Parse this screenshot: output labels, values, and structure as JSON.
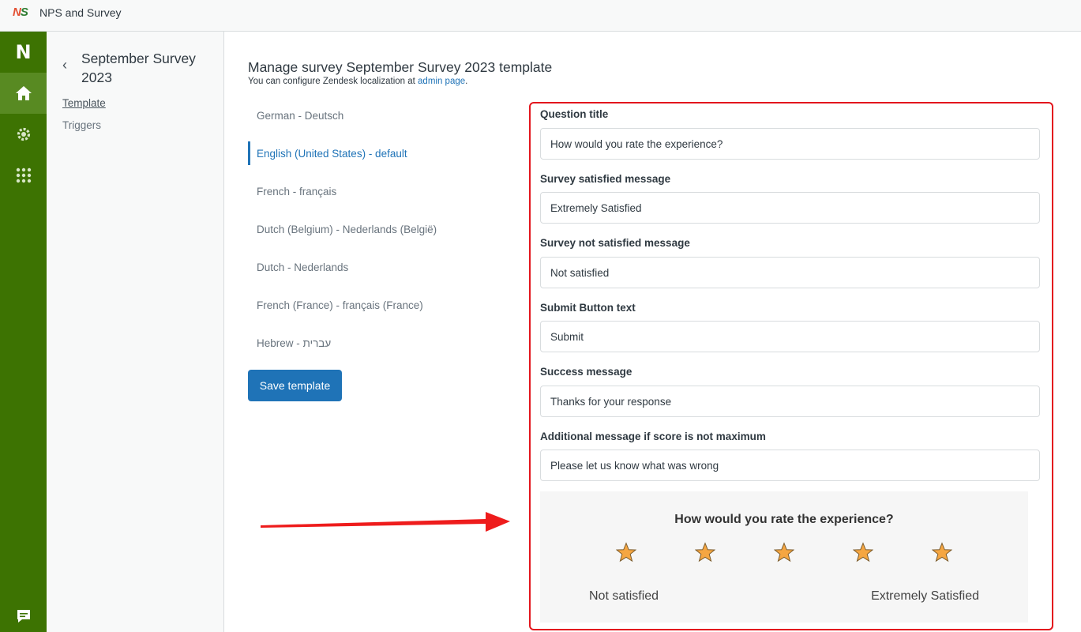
{
  "app": {
    "logo_text": "NS",
    "title": "NPS and Survey"
  },
  "rail": {
    "brand_letter": "N"
  },
  "subnav": {
    "title": "September Survey 2023",
    "links": [
      {
        "label": "Template"
      },
      {
        "label": "Triggers"
      }
    ]
  },
  "page": {
    "heading": "Manage survey September Survey 2023 template",
    "sub_prefix": "You can configure Zendesk localization at",
    "sub_link": "admin page",
    "sub_suffix": "."
  },
  "languages": [
    "German - Deutsch",
    "English (United States) - default",
    "French - français",
    "Dutch (Belgium) - Nederlands (België)",
    "Dutch - Nederlands",
    "French (France) - français (France)",
    "Hebrew - עברית"
  ],
  "active_language_index": 1,
  "save_button": "Save template",
  "form": {
    "fields": [
      {
        "label": "Question title",
        "value": "How would you rate the experience?"
      },
      {
        "label": "Survey satisfied message",
        "value": "Extremely Satisfied"
      },
      {
        "label": "Survey not satisfied message",
        "value": "Not satisfied"
      },
      {
        "label": "Submit Button text",
        "value": "Submit"
      },
      {
        "label": "Success message",
        "value": "Thanks for your response"
      },
      {
        "label": "Additional message if score is not maximum",
        "value": "Please let us know what was wrong"
      }
    ]
  },
  "preview": {
    "question": "How would you rate the experience?",
    "star_count": 5,
    "low_label": "Not satisfied",
    "high_label": "Extremely Satisfied"
  },
  "colors": {
    "rail": "#3d7302",
    "primary": "#1f73b7",
    "highlight_border": "#e3161d",
    "star_fill": "#f5a642"
  }
}
